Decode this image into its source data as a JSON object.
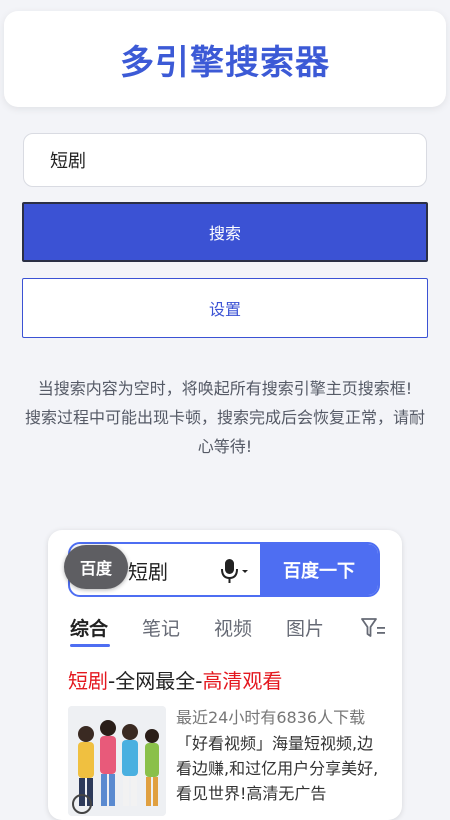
{
  "header": {
    "title": "多引擎搜索器"
  },
  "search": {
    "value": "短剧"
  },
  "buttons": {
    "search_label": "搜索",
    "settings_label": "设置"
  },
  "hint": {
    "line1": "当搜索内容为空时，将唤起所有搜索引擎主页搜索框!",
    "line2": "搜索过程中可能出现卡顿，搜索完成后会恢复正常，请耐心等待!"
  },
  "preview": {
    "logo_text": "百度",
    "query": "短剧",
    "button_label": "百度一下",
    "tabs": [
      {
        "label": "综合"
      },
      {
        "label": "笔记"
      },
      {
        "label": "视频"
      },
      {
        "label": "图片"
      }
    ],
    "result": {
      "title_hl1": "短剧",
      "title_mid": "-全网最全-",
      "title_hl2": "高清观看",
      "meta": "最近24小时有6836人下载",
      "desc": "「好看视频」海量短视频,边看边赚,和过亿用户分享美好,看见世界!高清无广告"
    },
    "colors": {
      "accent": "#3b52d4",
      "baidu_blue": "#4e6ef2",
      "highlight_red": "#e4181f"
    }
  }
}
